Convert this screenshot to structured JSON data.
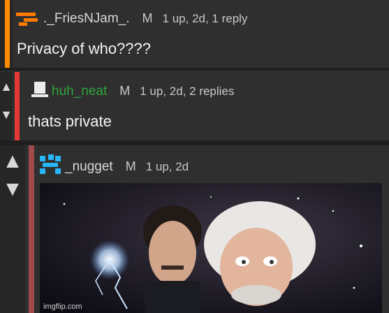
{
  "comments": [
    {
      "username": "._FriesNJam_.",
      "mod_badge": "M",
      "stats": "1 up, 2d, 1 reply",
      "text": "Privacy of who????",
      "bar_color": "#ff8c00"
    },
    {
      "username": "huh_neat",
      "mod_badge": "M",
      "stats": "1 up, 2d, 2 replies",
      "text": "thats private",
      "bar_color": "#e53935",
      "username_color": "#2ea43b"
    },
    {
      "username": "_nugget",
      "mod_badge": "M",
      "stats": "1 up, 2d",
      "bar_color": "#9e4a4a"
    }
  ],
  "watermark": "imgflip.com",
  "icons": {
    "upvote": "▲",
    "downvote": "▼"
  }
}
